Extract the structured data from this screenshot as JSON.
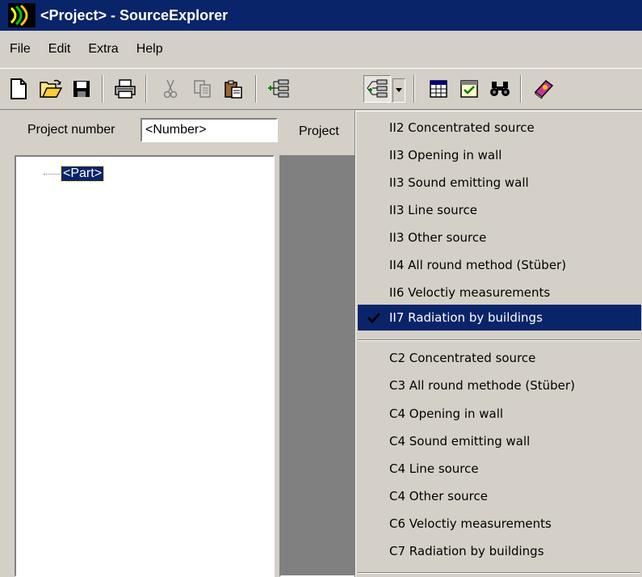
{
  "window": {
    "title": "<Project> - SourceExplorer"
  },
  "menu": {
    "items": [
      "File",
      "Edit",
      "Extra",
      "Help"
    ]
  },
  "toolbar": {
    "buttons": [
      "new-icon",
      "open-icon",
      "save-icon",
      "print-icon",
      "cut-icon",
      "copy-icon",
      "paste-icon",
      "add-node-icon",
      "source-type-icon",
      "table-icon",
      "check-icon",
      "find-icon",
      "help-book-icon"
    ]
  },
  "left": {
    "project_number_label": "Project number",
    "project_number_value": "<Number>",
    "project_label_2": "Project",
    "tree_node": "<Part>"
  },
  "dropdown": {
    "group1": [
      "II2 Concentrated source",
      "II3 Opening in wall",
      "II3 Sound emitting wall",
      "II3 Line source",
      "II3 Other source",
      "II4 All round method (Stüber)",
      "II6 Veloctiy measurements",
      "II7 Radiation by buildings"
    ],
    "group2": [
      "C2 Concentrated source",
      "C3 All round methode (Stüber)",
      "C4 Opening in wall",
      "C4 Sound emitting wall",
      "C4 Line source",
      "C4 Other source",
      "C6 Veloctiy measurements",
      "C7 Radiation by buildings"
    ],
    "checked_item": "II7 Radiation by buildings"
  },
  "colors": {
    "titlebar": "#0a246a",
    "face": "#d4d0c8",
    "highlight": "#0a246a"
  }
}
